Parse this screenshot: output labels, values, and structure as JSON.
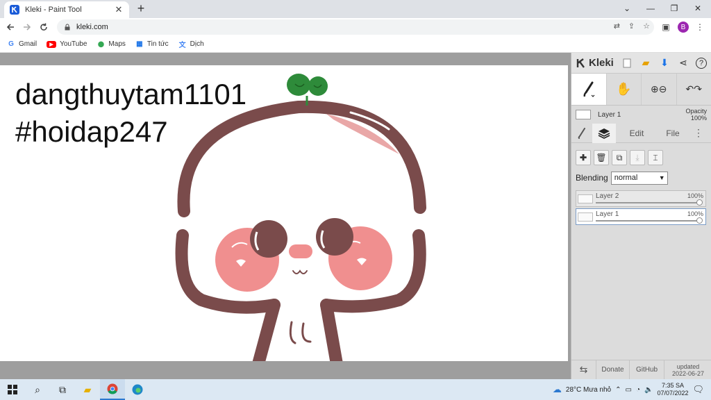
{
  "browser": {
    "tab_title": "Kleki - Paint Tool",
    "tab_close": "✕",
    "new_tab": "+",
    "url": "kleki.com",
    "profile_initial": "B",
    "window_controls": [
      "⌄",
      "—",
      "❐",
      "✕"
    ]
  },
  "bookmarks": [
    {
      "label": "Gmail",
      "icon": "google-icon",
      "glyph": "G",
      "color": "#4285f4"
    },
    {
      "label": "YouTube",
      "icon": "youtube-icon",
      "glyph": "▶",
      "color": "#ff0000"
    },
    {
      "label": "Maps",
      "icon": "maps-icon",
      "glyph": "⬤",
      "color": "#34a853"
    },
    {
      "label": "Tin tức",
      "icon": "news-icon",
      "glyph": "▦",
      "color": "#1a73e8"
    },
    {
      "label": "Dịch",
      "icon": "translate-icon",
      "glyph": "文",
      "color": "#4285f4"
    }
  ],
  "canvas": {
    "lines": [
      "dangthuytam1101",
      "#hoidap247"
    ]
  },
  "kleki": {
    "logo_text": "Kleki",
    "layer_preview": {
      "name": "Layer 1",
      "opacity_label": "Opacity",
      "opacity_value": "100%"
    },
    "tabs": [
      {
        "label": "",
        "icon": "brush-icon"
      },
      {
        "label": "",
        "icon": "layers-icon"
      },
      {
        "label": "Edit",
        "icon": ""
      },
      {
        "label": "File",
        "icon": ""
      },
      {
        "label": "",
        "icon": "more-icon"
      }
    ],
    "blending_label": "Blending",
    "blending_value": "normal",
    "layers": [
      {
        "name": "Layer 2",
        "opacity": "100%",
        "selected": false
      },
      {
        "name": "Layer 1",
        "opacity": "100%",
        "selected": true
      }
    ],
    "footer": {
      "donate": "Donate",
      "github": "GitHub",
      "updated_label": "updated",
      "updated_date": "2022-06-27"
    }
  },
  "taskbar": {
    "weather": "28°C  Mưa nhỏ",
    "time": "7:35 SA",
    "date": "07/07/2022"
  },
  "colors": {
    "accent": "#1a5bd8",
    "outline": "#7a4b4b",
    "blush": "#f08f8f",
    "sprout": "#2e8b3a"
  }
}
